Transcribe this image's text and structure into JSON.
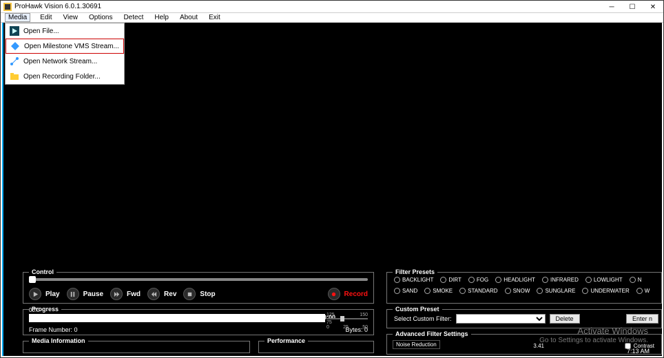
{
  "window": {
    "title": "ProHawk Vision 6.0.1.30691"
  },
  "menubar": [
    "Media",
    "Edit",
    "View",
    "Options",
    "Detect",
    "Help",
    "About",
    "Exit"
  ],
  "dropdown": {
    "items": [
      {
        "label": "Open File..."
      },
      {
        "label": "Open Milestone VMS Stream..."
      },
      {
        "label": "Open Network Stream..."
      },
      {
        "label": "Open Recording Folder..."
      }
    ],
    "highlight_index": 1
  },
  "control": {
    "legend": "Control",
    "buttons": {
      "play": "Play",
      "pause": "Pause",
      "fwd": "Fwd",
      "rev": "Rev",
      "stop": "Stop",
      "record": "Record"
    }
  },
  "progress": {
    "legend": "Progress",
    "start": "00:0",
    "end": "00:00",
    "frame_label": "Frame Number: 0",
    "bytes_label": "Bytes: 0",
    "ticks": {
      "a": "125",
      "b": "150",
      "c": "75",
      "d": "0",
      "e": "25",
      "f": "50"
    }
  },
  "mediainfo": {
    "legend": "Media Information"
  },
  "performance": {
    "legend": "Performance"
  },
  "filter_presets": {
    "legend": "Filter Presets",
    "row1": [
      "BACKLIGHT",
      "DIRT",
      "FOG",
      "HEADLIGHT",
      "INFRARED",
      "LOWLIGHT",
      "N"
    ],
    "row2": [
      "SAND",
      "SMOKE",
      "STANDARD",
      "SNOW",
      "SUNGLARE",
      "UNDERWATER",
      "W"
    ]
  },
  "custom_preset": {
    "legend": "Custom Preset",
    "label": "Select Custom Filter:",
    "delete": "Delete",
    "enter": "Enter n"
  },
  "adv_filter": {
    "legend": "Advanced Filter Settings",
    "sub": "Noise Reduction",
    "num": "3.41",
    "contrast_label": "Contrast"
  },
  "watermark": {
    "line1": "Activate Windows",
    "line2": "Go to Settings to activate Windows."
  },
  "clock": "7:13 AM"
}
